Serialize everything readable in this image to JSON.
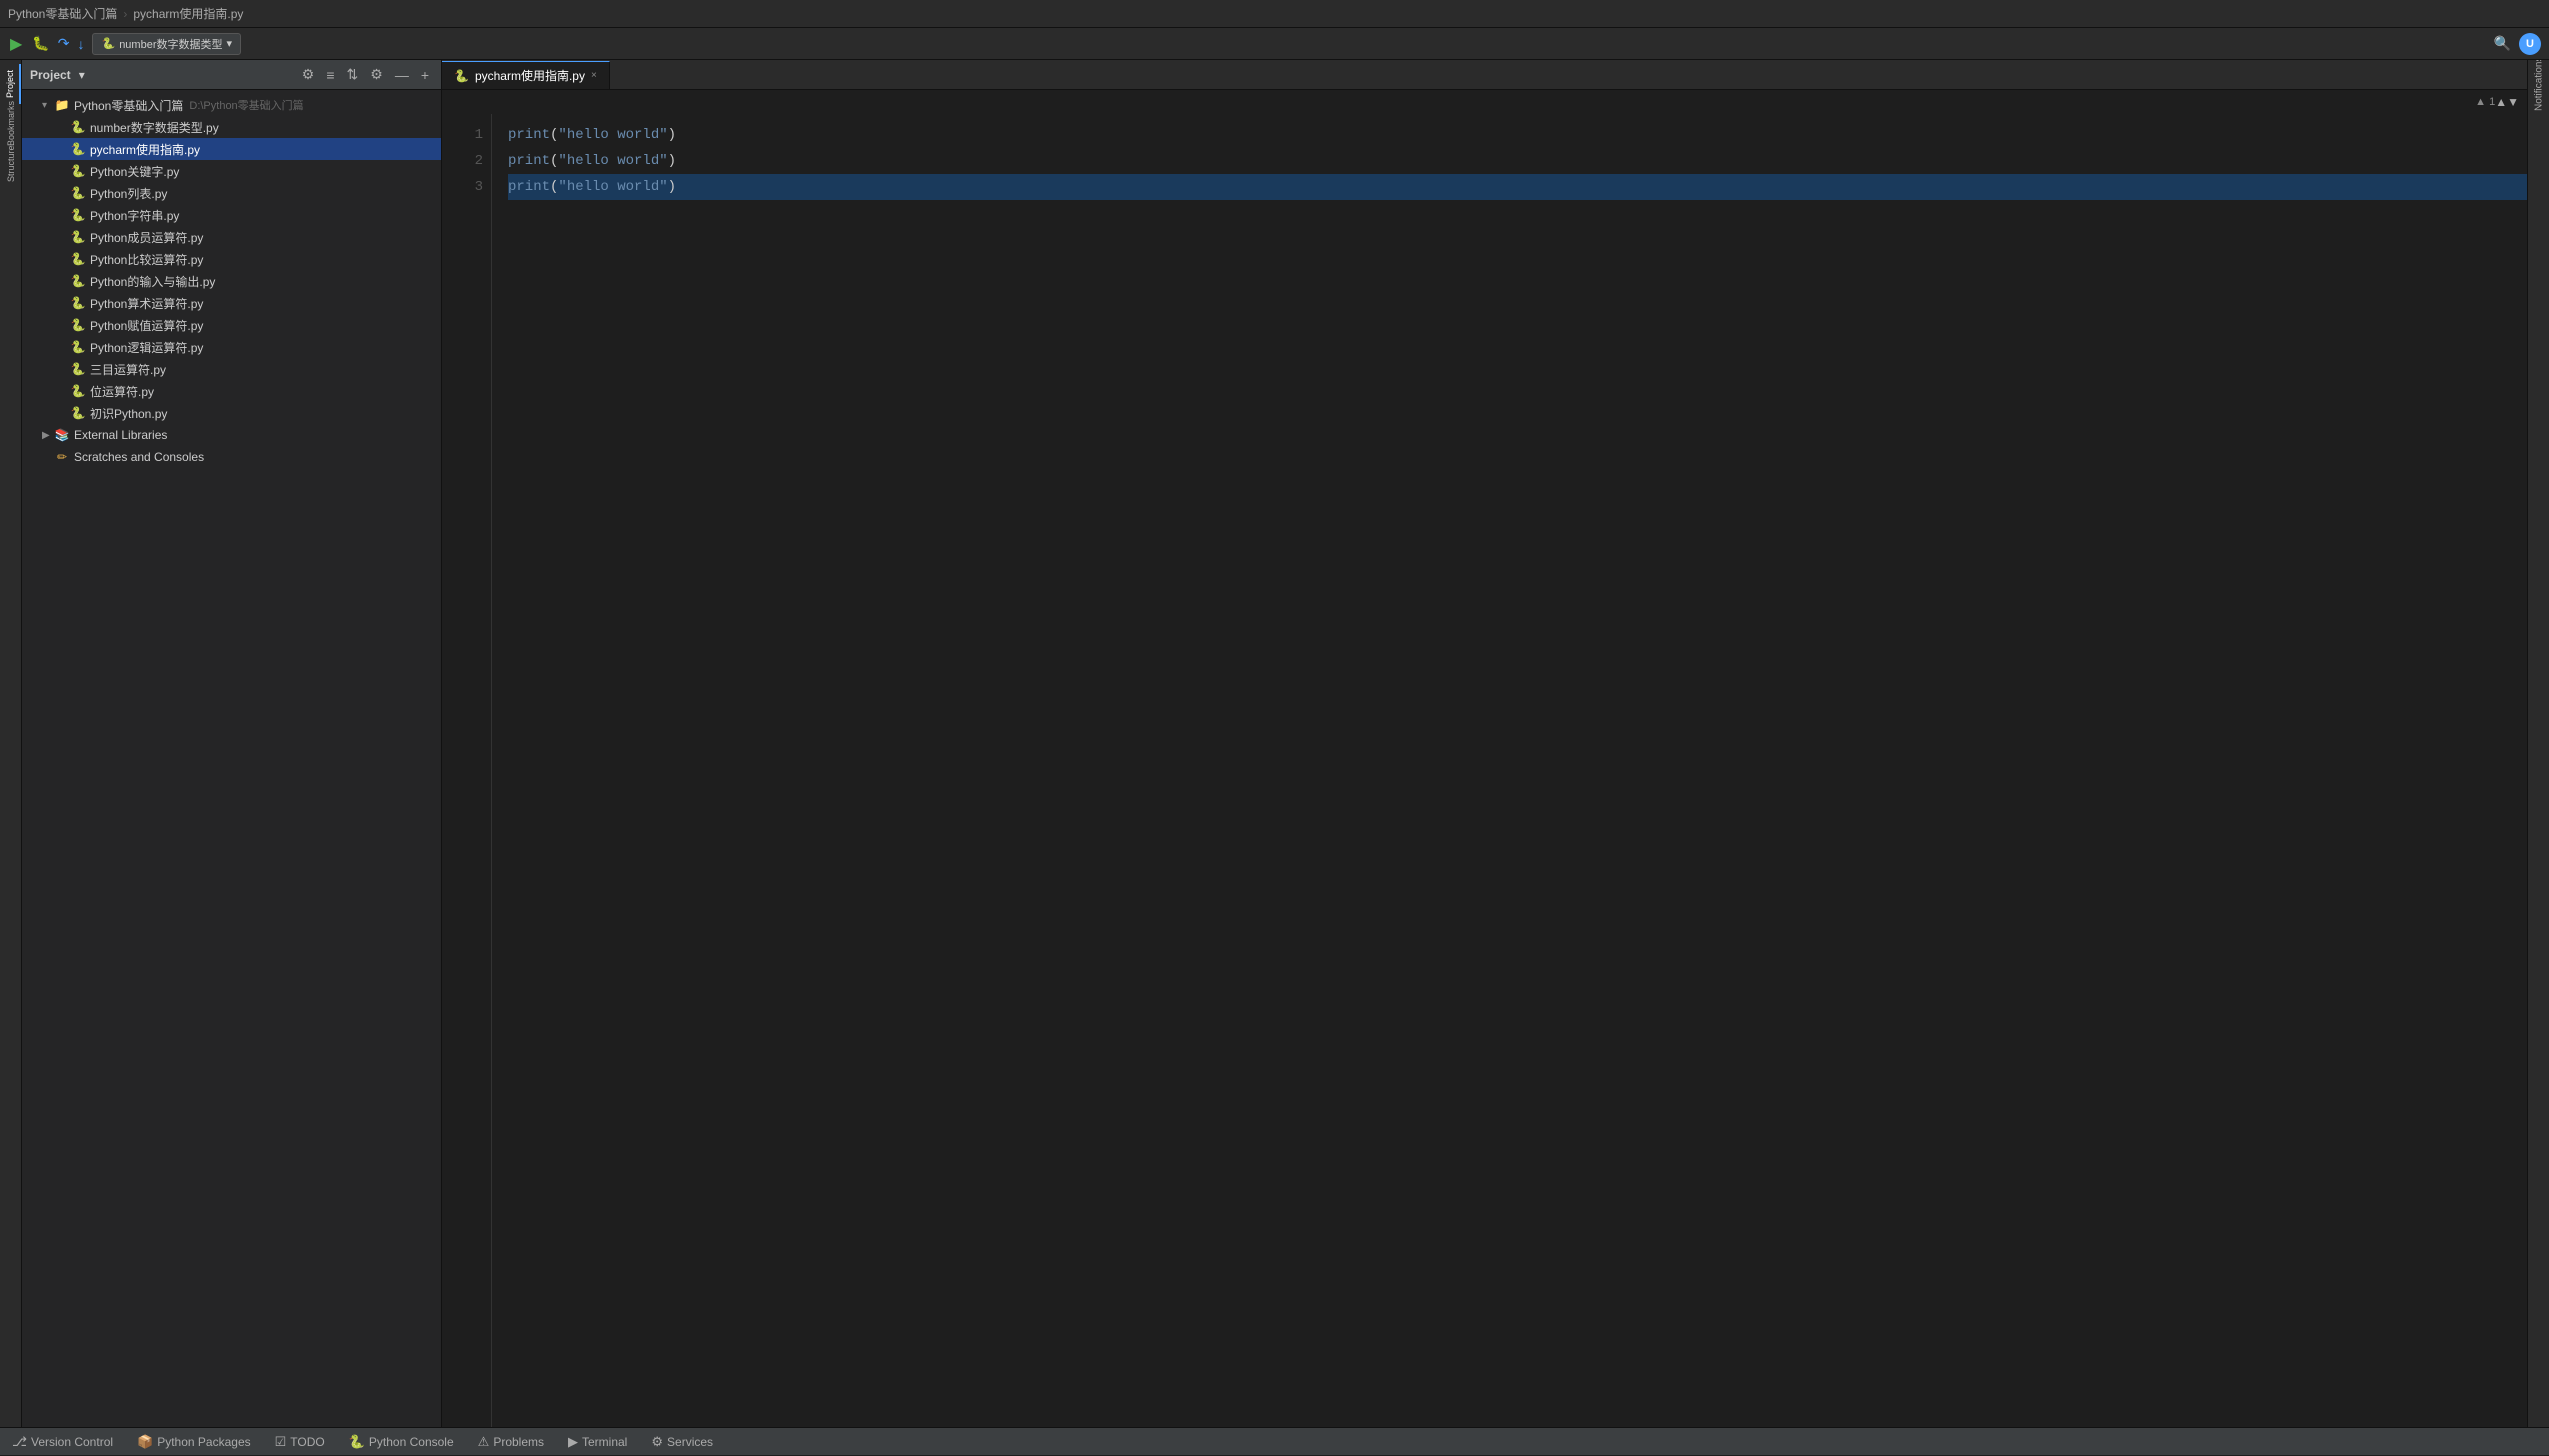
{
  "titlebar": {
    "project_name": "Python零基础入门篇",
    "file_name": "pycharm使用指南.py",
    "separator": "›"
  },
  "interpreter": {
    "label": "number数字数据类型"
  },
  "sidebar": {
    "header": "Project",
    "dropdown_arrow": "▾",
    "actions": [
      "⚙",
      "≡",
      "⇅",
      "⚙",
      "—",
      "+"
    ]
  },
  "file_tree": {
    "items": [
      {
        "id": "root-folder",
        "indent": 1,
        "arrow": "▾",
        "icon": "folder",
        "name": "Python零基础入门篇",
        "path": "D:\\Python零基础入门篇",
        "active": false
      },
      {
        "id": "number-file",
        "indent": 2,
        "arrow": "",
        "icon": "py",
        "name": "number数字数据类型.py",
        "active": false
      },
      {
        "id": "pycharm-file",
        "indent": 2,
        "arrow": "",
        "icon": "py",
        "name": "pycharm使用指南.py",
        "active": true
      },
      {
        "id": "keywords-file",
        "indent": 2,
        "arrow": "",
        "icon": "py",
        "name": "Python关键字.py",
        "active": false
      },
      {
        "id": "list-file",
        "indent": 2,
        "arrow": "",
        "icon": "py",
        "name": "Python列表.py",
        "active": false
      },
      {
        "id": "string-file",
        "indent": 2,
        "arrow": "",
        "icon": "py",
        "name": "Python字符串.py",
        "active": false
      },
      {
        "id": "member-file",
        "indent": 2,
        "arrow": "",
        "icon": "py",
        "name": "Python成员运算符.py",
        "active": false
      },
      {
        "id": "compare-file",
        "indent": 2,
        "arrow": "",
        "icon": "py",
        "name": "Python比较运算符.py",
        "active": false
      },
      {
        "id": "io-file",
        "indent": 2,
        "arrow": "",
        "icon": "py",
        "name": "Python的输入与输出.py",
        "active": false
      },
      {
        "id": "arith-file",
        "indent": 2,
        "arrow": "",
        "icon": "py",
        "name": "Python算术运算符.py",
        "active": false
      },
      {
        "id": "assign-file",
        "indent": 2,
        "arrow": "",
        "icon": "py",
        "name": "Python赋值运算符.py",
        "active": false
      },
      {
        "id": "logic-file",
        "indent": 2,
        "arrow": "",
        "icon": "py",
        "name": "Python逻辑运算符.py",
        "active": false
      },
      {
        "id": "ternary-file",
        "indent": 2,
        "arrow": "",
        "icon": "py",
        "name": "三目运算符.py",
        "active": false
      },
      {
        "id": "bit-file",
        "indent": 2,
        "arrow": "",
        "icon": "py",
        "name": "位运算符.py",
        "active": false
      },
      {
        "id": "intro-file",
        "indent": 2,
        "arrow": "",
        "icon": "py",
        "name": "初识Python.py",
        "active": false
      },
      {
        "id": "ext-libs",
        "indent": 1,
        "arrow": "▶",
        "icon": "lib",
        "name": "External Libraries",
        "active": false
      },
      {
        "id": "scratches",
        "indent": 1,
        "arrow": "",
        "icon": "scratch",
        "name": "Scratches and Consoles",
        "active": false
      }
    ]
  },
  "editor": {
    "tab_name": "pycharm使用指南.py",
    "tab_icon": "🐍",
    "close_icon": "×",
    "line_count_info": "▲ 1",
    "lines": [
      {
        "num": 1,
        "content": "print(\"hello world\")",
        "highlighted": false
      },
      {
        "num": 2,
        "content": "print(\"hello world\")",
        "highlighted": false
      },
      {
        "num": 3,
        "content": "print(\"hello world\")",
        "highlighted": true
      }
    ]
  },
  "status_bar": {
    "items": [
      {
        "id": "version-control",
        "icon": "⎇",
        "label": "Version Control"
      },
      {
        "id": "python-packages",
        "icon": "📦",
        "label": "Python Packages"
      },
      {
        "id": "todo",
        "icon": "☑",
        "label": "TODO"
      },
      {
        "id": "python-console",
        "icon": "🐍",
        "label": "Python Console"
      },
      {
        "id": "problems",
        "icon": "⚠",
        "label": "Problems"
      },
      {
        "id": "terminal",
        "icon": "▶",
        "label": "Terminal"
      },
      {
        "id": "services",
        "icon": "⚙",
        "label": "Services"
      }
    ]
  },
  "right_panel": {
    "label": "Notifications"
  },
  "activity_bar": {
    "items": [
      {
        "id": "project",
        "label": "Project"
      },
      {
        "id": "bookmarks",
        "label": "Bookmarks"
      },
      {
        "id": "structure",
        "label": "Structure"
      }
    ]
  }
}
